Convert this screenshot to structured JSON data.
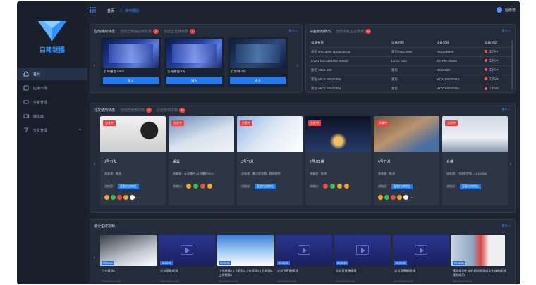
{
  "brand": {
    "name": "目睹制播"
  },
  "sidebar": {
    "items": [
      {
        "label": "首页",
        "icon": "home-icon"
      },
      {
        "label": "应用市场",
        "icon": "app-icon"
      },
      {
        "label": "设备管理",
        "icon": "device-icon"
      },
      {
        "label": "媒体库",
        "icon": "media-icon"
      },
      {
        "label": "分发管理",
        "icon": "distribute-icon"
      }
    ]
  },
  "topbar": {
    "home": "首页",
    "link": "使用帮助",
    "user": "超级管"
  },
  "apps": {
    "title": "应用使用状态",
    "sub1": "当前已使用应用数量",
    "badge1": "2",
    "sub2": "当前正在使用数",
    "badge2": "3",
    "more": "更多>>",
    "cards": [
      {
        "name": "云导播台-Next",
        "btn": "进入"
      },
      {
        "name": "云导播台-1号",
        "btn": "进入"
      },
      {
        "name": "云剪辑-1号",
        "btn": "进入"
      }
    ]
  },
  "devices": {
    "title": "设备使用状态",
    "sub": "当前设备正在使用",
    "badge": "10",
    "more": "更多>>",
    "headers": [
      "设备名称",
      "设备品牌",
      "设备型号",
      "设备状态"
    ],
    "rows": [
      [
        "索尼 NSCaster NS9205N45",
        "索尼 NSCaster",
        "NS9205N45",
        "工作中"
      ],
      [
        "LiveU Solo 201709-20822",
        "LiveU Solo",
        "201709-20822",
        "工作中"
      ],
      [
        "索尼 MCX-500",
        "索尼",
        "MCX-500",
        "工作中"
      ],
      [
        "索尼 MCX-S6520384",
        "索尼",
        "MCX-S6520384",
        "工作中"
      ],
      [
        "索尼 MCX-S6520384",
        "索尼",
        "MCX-S6520384",
        "工作中"
      ]
    ]
  },
  "dist": {
    "title": "分发使用状态",
    "sub1": "当前已使用次数",
    "badge1": "2",
    "sub2": "历史使用次数",
    "badge2": "32",
    "more": "更多>>",
    "cards": [
      {
        "tag": "分发中",
        "title": "1号分发",
        "l1": "流来源：推流",
        "l2": "流链接：",
        "btn": "复制拉流地址"
      },
      {
        "tag": "分发中",
        "title": "采集",
        "l1": "流来源：云导播台-云导播台NEXT",
        "l2": "流输出：",
        "btn": ""
      },
      {
        "tag": "分发中",
        "title": "3号分发",
        "l1": "流来源：腾讯等视频 - 我的视频",
        "l2": "流链接：",
        "btn": "复制拉流地址"
      },
      {
        "tag": "分发中",
        "title": "7月7日播",
        "l1": "流来源：推流",
        "l2": "流输出：",
        "btn": ""
      },
      {
        "tag": "分发中",
        "title": "4号分发",
        "l1": "流来源：推流",
        "l2": "流链接：",
        "btn": "复制拉流地址"
      },
      {
        "tag": "分发中",
        "title": "直播",
        "l1": "流来源：拉流等视频 - 20190528",
        "l2": "流链接：",
        "btn": "复制拉流地址"
      }
    ]
  },
  "videos": {
    "title": "最近生成视频",
    "more": "更多>>",
    "cards": [
      {
        "time": "00:03:20",
        "title": "工作视频2",
        "date": "2019/09/09 10:00"
      },
      {
        "time": "00:23:29",
        "title": "会议室录视频",
        "date": "2019/09/09 10:00"
      },
      {
        "time": "00:03:20",
        "title": "工作视频2工作视频2工作视频2工作视频2工作视频2",
        "date": "2019/09/09 10:00"
      },
      {
        "time": "00:23:29",
        "title": "会议室直播视频",
        "date": "2019/09/09 10:00"
      },
      {
        "time": "00:23:29",
        "title": "会议室直播视频",
        "date": "2019/09/09 10:00"
      },
      {
        "time": "00:23:29",
        "title": "会议室直播视频",
        "date": "2019/09/09 10:00"
      },
      {
        "time": "00:03:20",
        "title": "视频成功生成的视频视频成功生成的视频视频成功",
        "date": "2019/09/09 10:00"
      }
    ]
  }
}
